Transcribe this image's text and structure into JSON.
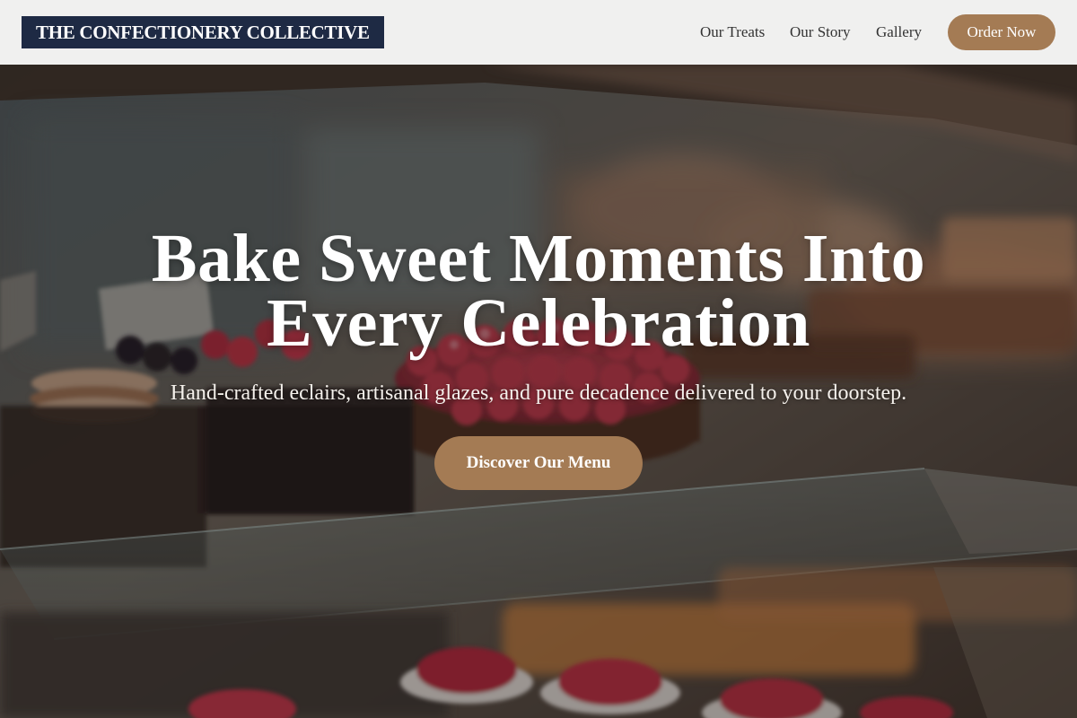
{
  "header": {
    "logo_text": "THE CONFECTIONERY COLLECTIVE",
    "nav": [
      {
        "label": "Our Treats"
      },
      {
        "label": "Our Story"
      },
      {
        "label": "Gallery"
      }
    ],
    "cta_label": "Order Now"
  },
  "hero": {
    "title_line1": "Bake Sweet Moments Into",
    "title_line2": "Every Celebration",
    "subtitle": "Hand-crafted eclairs, artisanal glazes, and pure decadence delivered to your doorstep.",
    "cta_label": "Discover Our Menu",
    "background": "bakery display case with raspberry tart and pastries"
  },
  "colors": {
    "header_bg": "#f0f0ef",
    "logo_bg": "#1e2a44",
    "accent": "#a47b54",
    "text_dark": "#333333",
    "text_light": "#ffffff"
  }
}
